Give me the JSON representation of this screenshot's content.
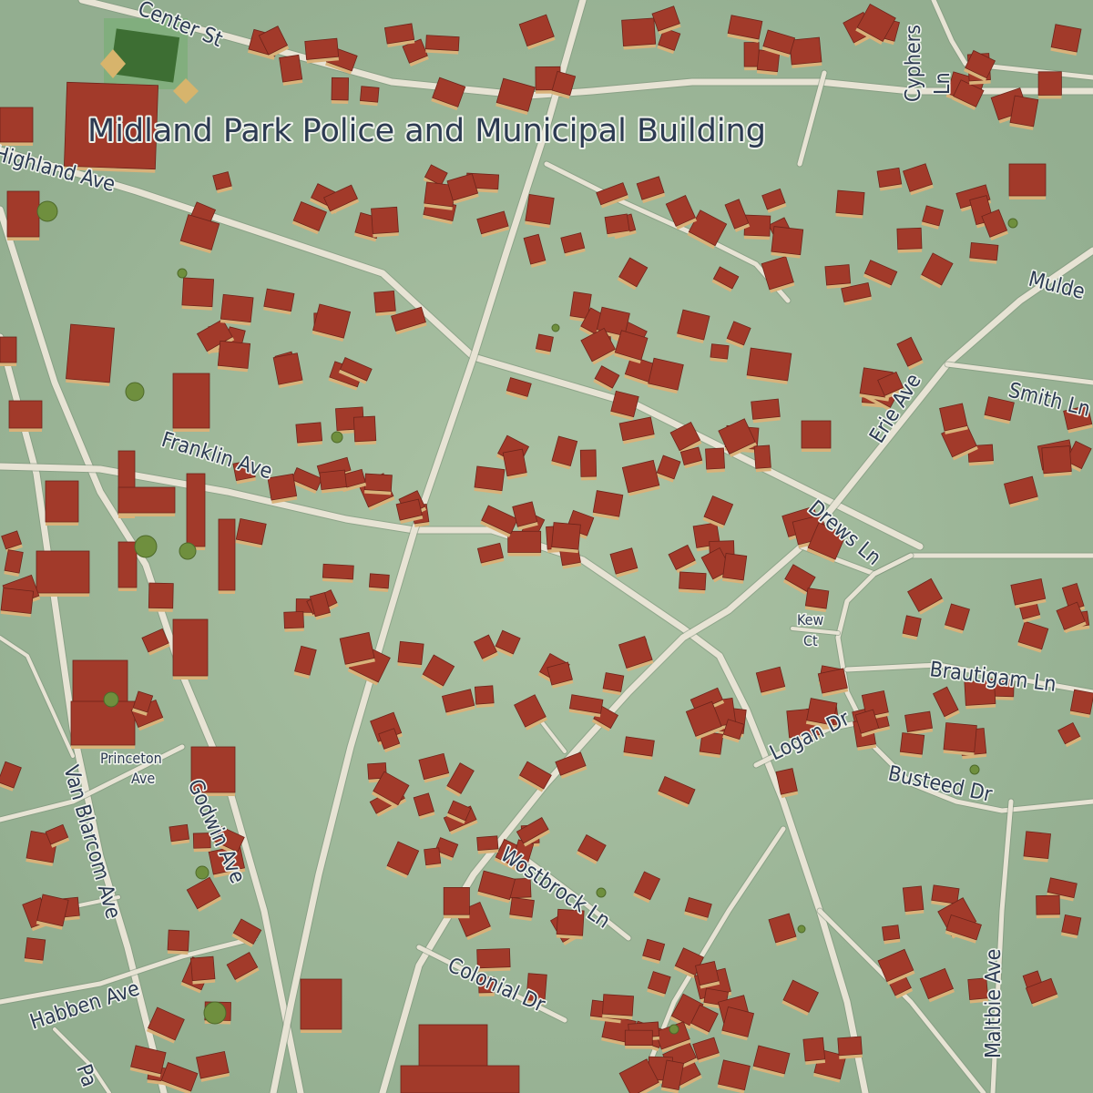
{
  "map": {
    "poi": {
      "label": "Midland Park Police and Municipal Building",
      "icon": "ballfield-icon"
    },
    "streets": {
      "center_st": "Center St",
      "highland_ave": "Highland Ave",
      "cyphers_ln_1": "Cyphers",
      "cyphers_ln_2": "Ln",
      "mulder": "Mulde",
      "erie_ave": "Erie Ave",
      "smith_ln": "Smith Ln",
      "franklin_ave": "Franklin Ave",
      "drews_ln": "Drews Ln",
      "kew_ct_1": "Kew",
      "kew_ct_2": "Ct",
      "brautigam_ln": "Brautigam Ln",
      "logan_dr": "Logan Dr",
      "busteed_dr": "Busteed Dr",
      "princeton_ave_1": "Princeton",
      "princeton_ave_2": "Ave",
      "van_blarcom_ave": "Van Blarcom Ave",
      "godwin_ave": "Godwin Ave",
      "wostbrock_ln": "Wostbrock Ln",
      "colonial_dr": "Colonial Dr",
      "maltbie_ave": "Maltbie Ave",
      "habben_ave": "Habben Ave",
      "pa_partial": "Pa"
    },
    "colors": {
      "ground": "#9fb99b",
      "road": "#e7e3d4",
      "building_roof": "#a23a2a",
      "building_side": "#d9b27a",
      "label_text": "#2c3a52",
      "tree": "#6f8f3e"
    }
  }
}
